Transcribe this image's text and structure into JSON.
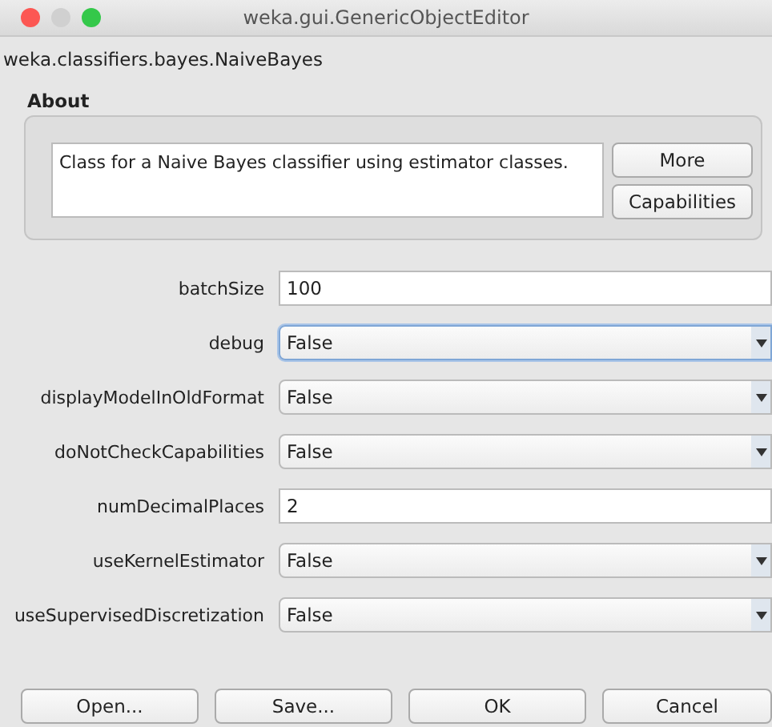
{
  "window": {
    "title": "weka.gui.GenericObjectEditor"
  },
  "class_name": "weka.classifiers.bayes.NaiveBayes",
  "about": {
    "label": "About",
    "text": "Class for a Naive Bayes classifier using estimator classes.",
    "buttons": [
      "More",
      "Capabilities"
    ]
  },
  "properties": [
    {
      "label": "batchSize",
      "kind": "text",
      "value": "100",
      "focused": false
    },
    {
      "label": "debug",
      "kind": "choice",
      "value": "False",
      "focused": true
    },
    {
      "label": "displayModelInOldFormat",
      "kind": "choice",
      "value": "False",
      "focused": false
    },
    {
      "label": "doNotCheckCapabilities",
      "kind": "choice",
      "value": "False",
      "focused": false
    },
    {
      "label": "numDecimalPlaces",
      "kind": "text",
      "value": "2",
      "focused": false
    },
    {
      "label": "useKernelEstimator",
      "kind": "choice",
      "value": "False",
      "focused": false
    },
    {
      "label": "useSupervisedDiscretization",
      "kind": "choice",
      "value": "False",
      "focused": false
    }
  ],
  "buttons": [
    "Open...",
    "Save...",
    "OK",
    "Cancel"
  ]
}
